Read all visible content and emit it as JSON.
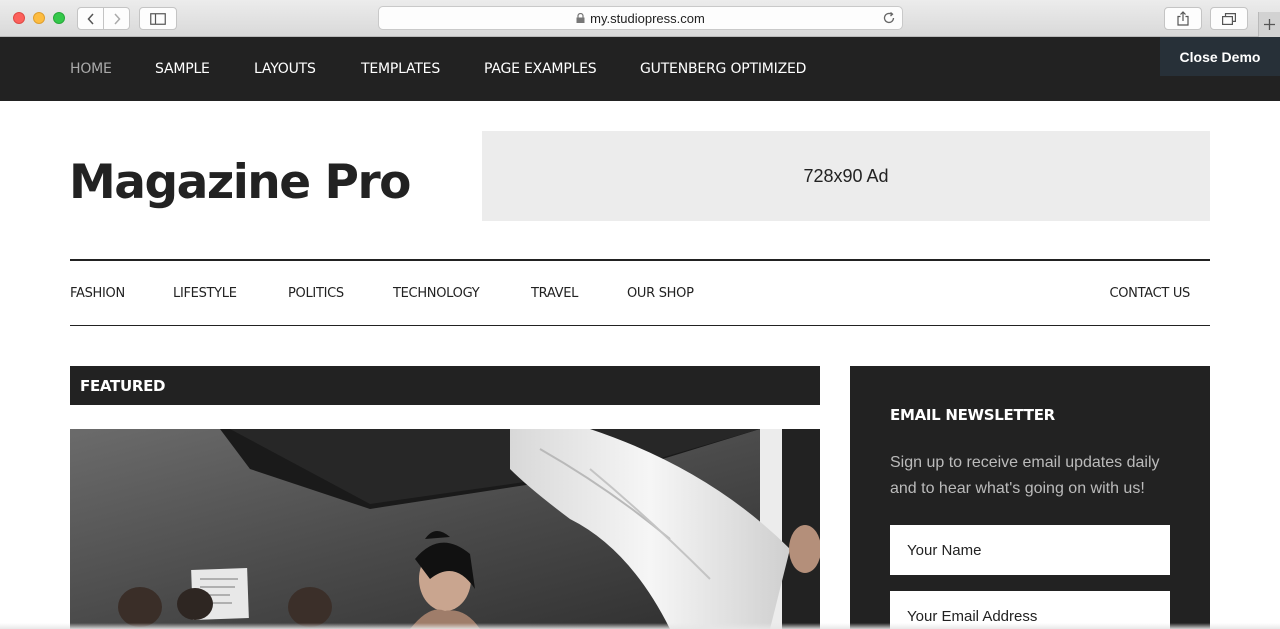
{
  "browser": {
    "url": "my.studiopress.com"
  },
  "top_nav": {
    "items": [
      {
        "label": "HOME"
      },
      {
        "label": "SAMPLE"
      },
      {
        "label": "LAYOUTS"
      },
      {
        "label": "TEMPLATES"
      },
      {
        "label": "PAGE EXAMPLES"
      },
      {
        "label": "GUTENBERG OPTIMIZED"
      }
    ],
    "active_index": 0,
    "close_demo": "Close Demo"
  },
  "header": {
    "site_title": "Magazine Pro",
    "ad_text": "728x90 Ad"
  },
  "secondary_nav": {
    "items": [
      {
        "label": "FASHION"
      },
      {
        "label": "LIFESTYLE"
      },
      {
        "label": "POLITICS"
      },
      {
        "label": "TECHNOLOGY"
      },
      {
        "label": "TRAVEL"
      },
      {
        "label": "OUR SHOP"
      }
    ],
    "right_item": "CONTACT US"
  },
  "featured": {
    "heading": "FEATURED"
  },
  "newsletter": {
    "title": "EMAIL NEWSLETTER",
    "text": "Sign up to receive email updates daily and to hear what's going on with us!",
    "name_placeholder": "Your Name",
    "email_placeholder": "Your Email Address"
  },
  "colors": {
    "nav_bg": "#222222",
    "close_demo_bg": "#273038",
    "ad_bg": "#ececec"
  }
}
